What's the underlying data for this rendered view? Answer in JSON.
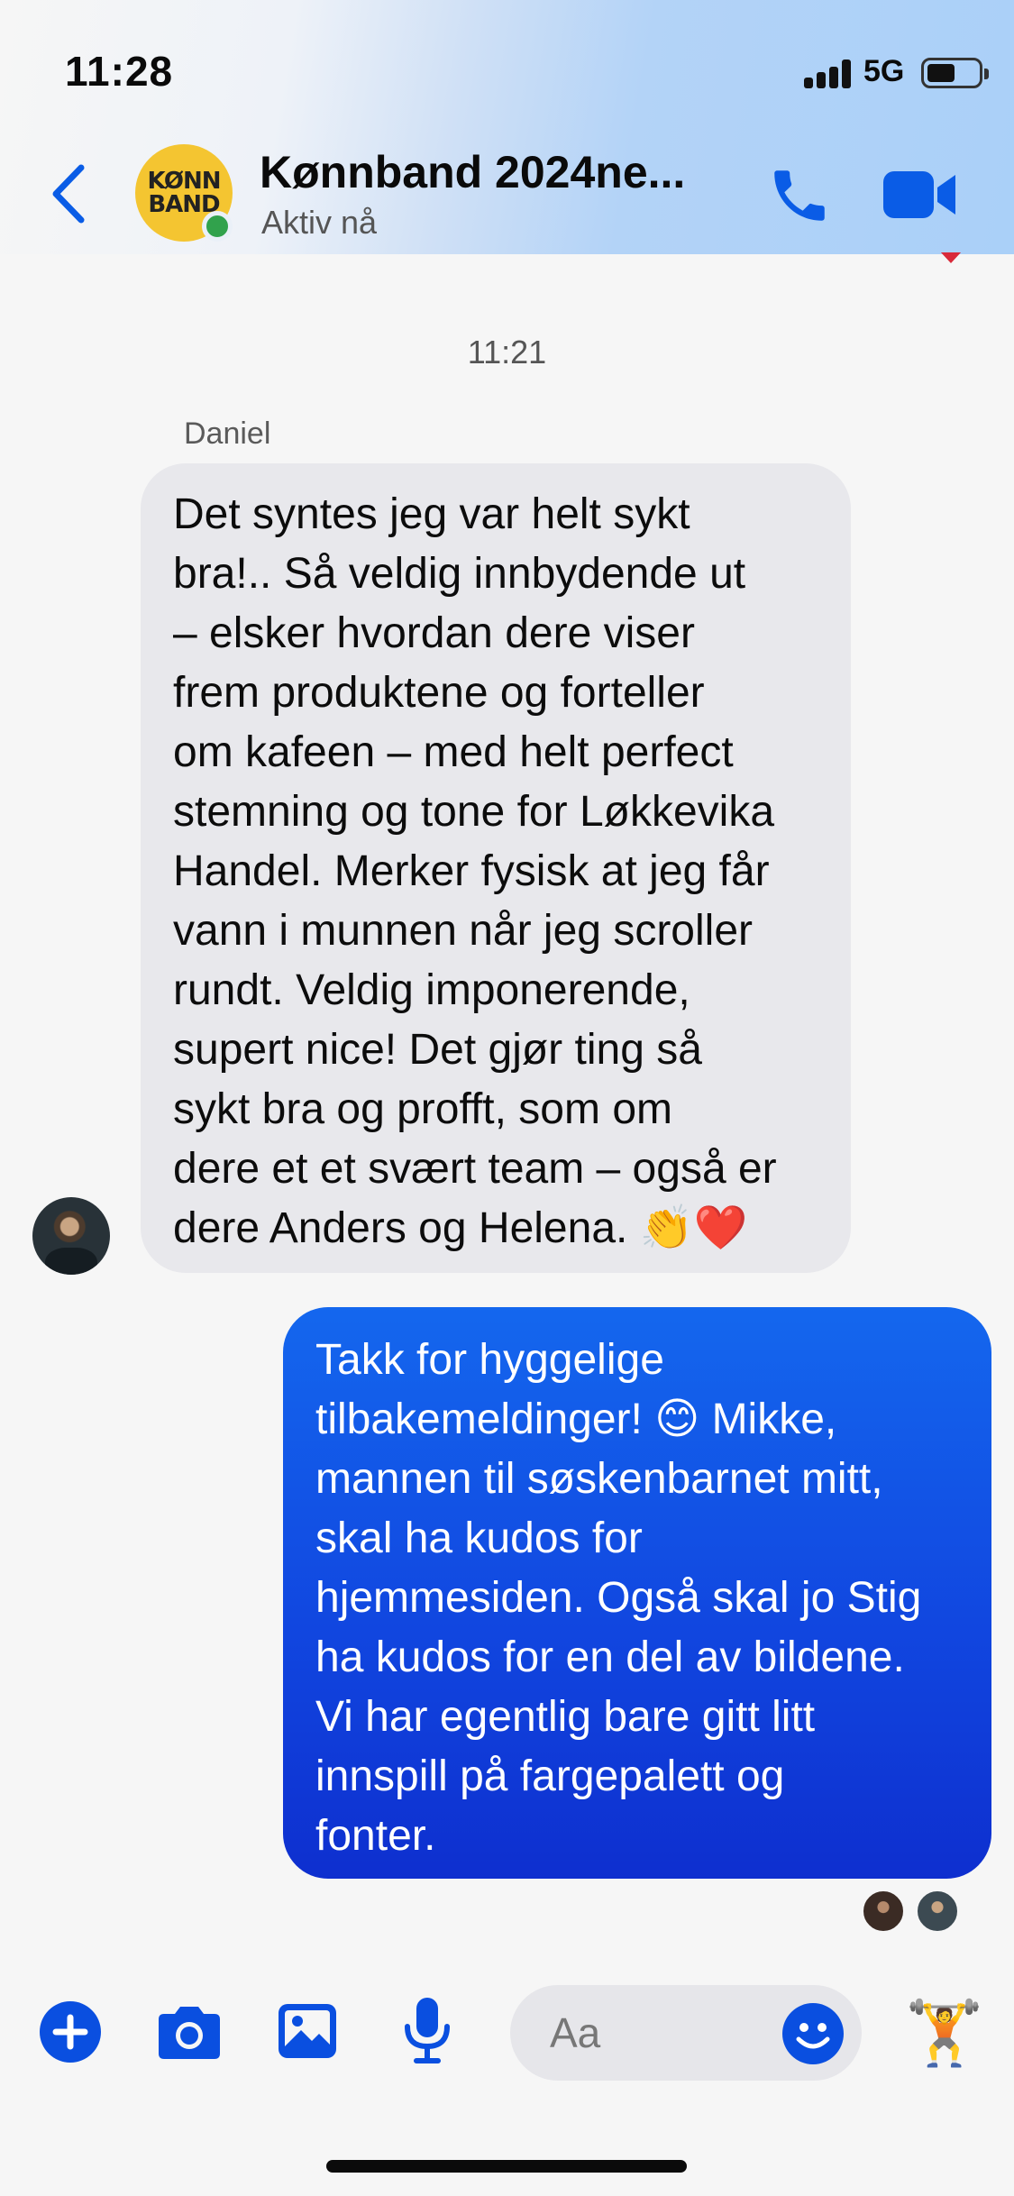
{
  "status_bar": {
    "time": "11:28",
    "network": "5G"
  },
  "header": {
    "back_icon": "chevron-left-icon",
    "group_avatar_text_line1": "KØNN",
    "group_avatar_text_line2": "BAND",
    "title": "Kønnband 2024ne...",
    "subtitle": "Aktiv nå",
    "call_icon": "phone-icon",
    "video_icon": "video-camera-icon",
    "accent_color": "#0a5ce6"
  },
  "conversation": {
    "timestamp": "11:21",
    "incoming": {
      "sender": "Daniel",
      "lines": [
        "Det syntes jeg var helt sykt",
        "bra!.. Så veldig innbydende ut",
        "– elsker hvordan dere viser",
        "frem produktene og forteller",
        "om kafeen – med helt perfect",
        "stemning og tone for Løkkevika",
        "Handel. Merker fysisk at jeg får",
        "vann i munnen når jeg scroller",
        "rundt. Veldig imponerende,",
        "supert nice! Det gjør ting så",
        "sykt bra og profft, som om",
        "dere et et svært team – også er",
        "dere Anders og Helena. 👏❤️"
      ],
      "bubble_color": "#e8e8ec"
    },
    "outgoing": {
      "lines": [
        "Takk for hyggelige",
        "tilbakemeldinger! 😊 Mikke,",
        "mannen til søskenbarnet mitt,",
        "skal ha kudos for",
        "hjemmesiden. Også skal jo Stig",
        "ha kudos for en del av bildene.",
        "Vi har egentlig bare gitt litt",
        "innspill på fargepalett og",
        "fonter."
      ],
      "bubble_color": "#1147e0"
    }
  },
  "composer": {
    "plus_icon": "plus-icon",
    "camera_icon": "camera-icon",
    "gallery_icon": "image-icon",
    "mic_icon": "microphone-icon",
    "placeholder": "Aa",
    "emoji_icon": "smiley-icon",
    "quick_reaction": "🏋️"
  }
}
